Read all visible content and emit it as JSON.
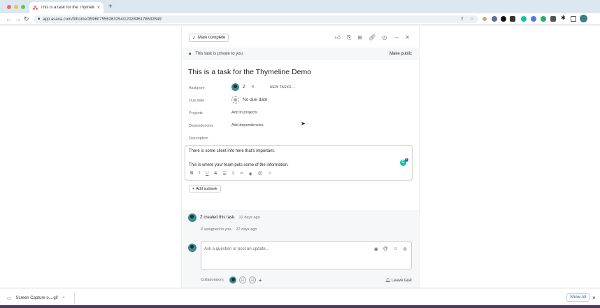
{
  "browser": {
    "tab_title": "This is a task for the Thymeline",
    "tab_close": "×",
    "new_tab": "+",
    "url": "app.asana.com/0/home/359607556263254/1202896176532849"
  },
  "toolbar": {
    "mark_complete": "Mark complete",
    "check_glyph": "✓"
  },
  "privacy": {
    "text": "This task is private to you.",
    "make_public": "Make public"
  },
  "task": {
    "title": "This is a task for the Thymeline Demo",
    "fields": {
      "assignee_label": "Assignee",
      "assignee_name": "Z",
      "assignee_remove": "×",
      "section": "NEW TASKS ⌄",
      "due_label": "Due date",
      "due_value": "No due date",
      "projects_label": "Projects",
      "projects_value": "Add to projects",
      "dependencies_label": "Dependencies",
      "dependencies_value": "Add dependencies",
      "description_label": "Description"
    },
    "description": {
      "line1": "There is some client info here that's important.",
      "line2": "This is where your team puts some of the information.",
      "grammarly_badge": "1"
    },
    "add_subtask": "Add subtask"
  },
  "activity": {
    "created_text": "Z created this task.",
    "created_time": "22 days ago",
    "assigned_text": "Z assigned to you.",
    "assigned_time": "22 days ago"
  },
  "comment": {
    "placeholder": "Ask a question or post an update..."
  },
  "collaborators": {
    "label": "Collaborators",
    "add": "+",
    "leave_task": "Leave task"
  },
  "downloads": {
    "file_name": "Screen Capture o....gif",
    "show_all": "Show All",
    "close": "×"
  }
}
